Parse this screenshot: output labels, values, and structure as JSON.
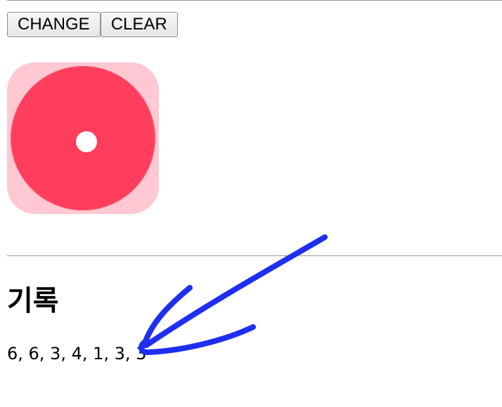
{
  "toolbar": {
    "change_label": "CHANGE",
    "clear_label": "CLEAR"
  },
  "dice": {
    "value": 1,
    "face_color": "#ff3d5c",
    "background_color": "#ffc8d2"
  },
  "history": {
    "title": "기록",
    "values": "6, 6, 3, 4, 1, 3, 3"
  },
  "annotation": {
    "type": "hand-drawn-arrow",
    "color": "#1f2ff0",
    "points_to": "history-values"
  }
}
